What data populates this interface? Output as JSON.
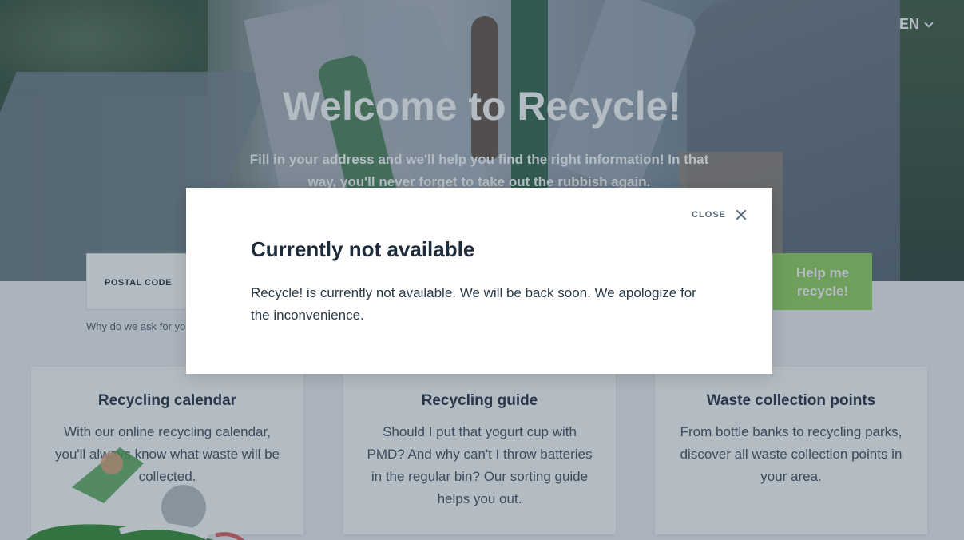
{
  "header": {
    "language": "EN",
    "title": "Welcome to Recycle!",
    "subtitle": "Fill in your address and we'll help you find the right information! In that way, you'll never forget to take out the rubbish again."
  },
  "form": {
    "postal_code_label": "POSTAL CODE",
    "submit_label": "Help me recycle!",
    "why_text": "Why do we ask for yo"
  },
  "cards": [
    {
      "title": "Recycling calendar",
      "text": "With our online recycling calendar, you'll always know what waste will be collected."
    },
    {
      "title": "Recycling guide",
      "text": "Should I put that yogurt cup with PMD? And why can't I throw batteries in the regular bin? Our sorting guide helps you out."
    },
    {
      "title": "Waste collection points",
      "text": "From bottle banks to recycling parks, discover all waste collection points in your area."
    }
  ],
  "modal": {
    "close_label": "CLOSE",
    "title": "Currently not available",
    "body": "Recycle! is currently not available. We will be back soon. We apologize for the inconvenience."
  },
  "colors": {
    "accent_green": "#8ed058",
    "text_dark": "#1d2b3a"
  }
}
